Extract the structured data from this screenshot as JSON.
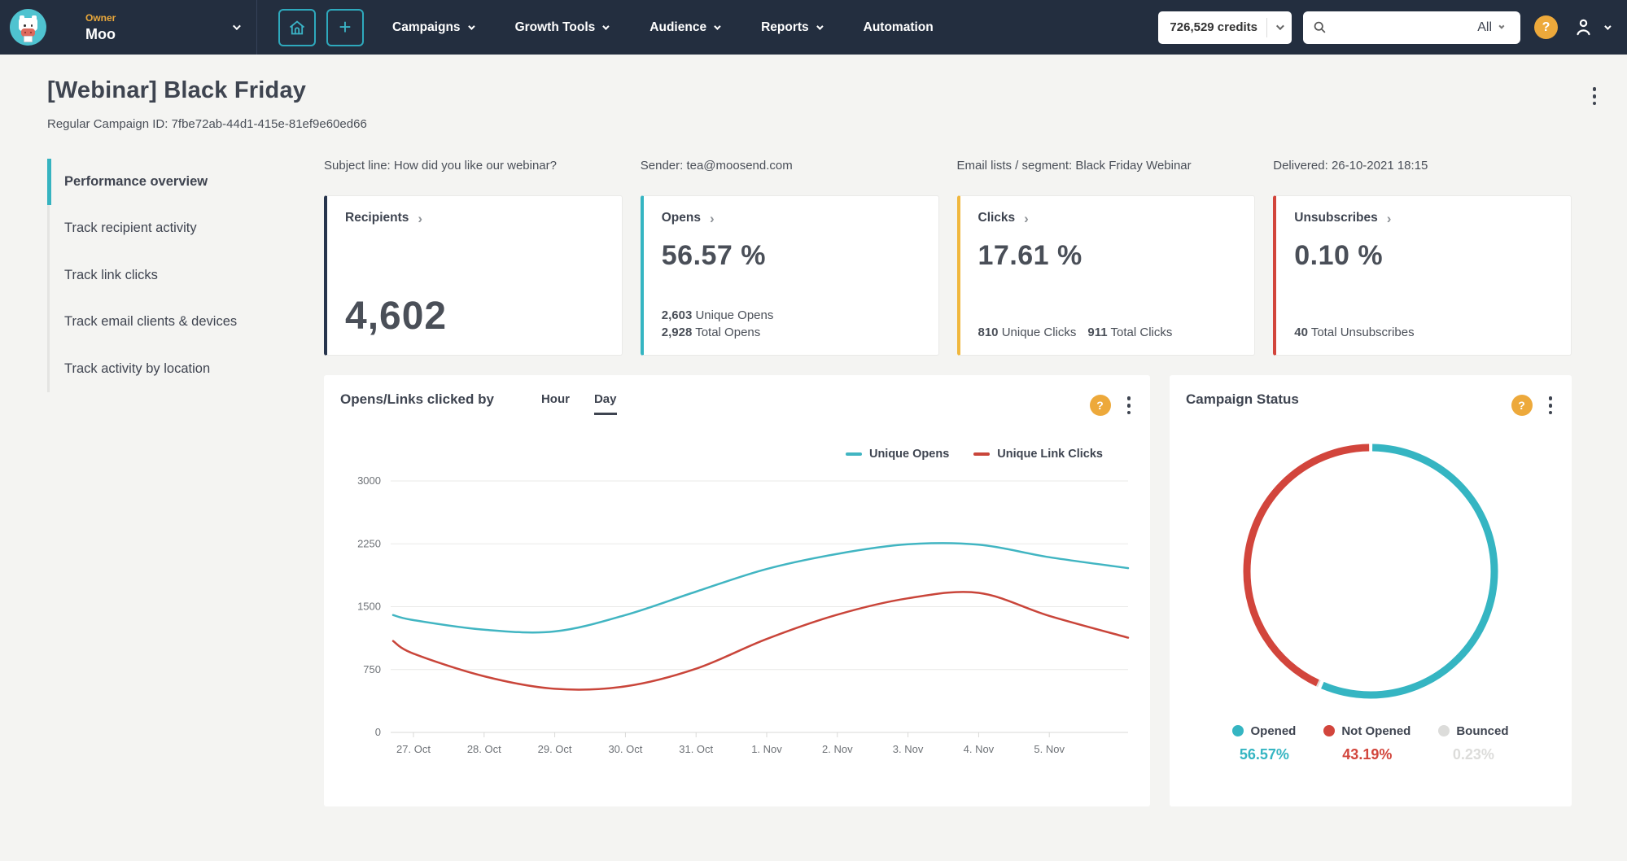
{
  "navbar": {
    "owner_label": "Owner",
    "account_name": "Moo",
    "menu": [
      {
        "label": "Campaigns",
        "chevron": true
      },
      {
        "label": "Growth Tools",
        "chevron": true
      },
      {
        "label": "Audience",
        "chevron": true
      },
      {
        "label": "Reports",
        "chevron": true
      },
      {
        "label": "Automation",
        "chevron": false
      }
    ],
    "credits": "726,529 credits",
    "search_filter": "All",
    "help_glyph": "?"
  },
  "page": {
    "title": "[Webinar] Black Friday",
    "subtitle": "Regular Campaign ID: 7fbe72ab-44d1-415e-81ef9e60ed66"
  },
  "sidebar": {
    "items": [
      {
        "label": "Performance overview",
        "active": true
      },
      {
        "label": "Track recipient activity",
        "active": false
      },
      {
        "label": "Track link clicks",
        "active": false
      },
      {
        "label": "Track email clients & devices",
        "active": false
      },
      {
        "label": "Track activity by location",
        "active": false
      }
    ]
  },
  "info": {
    "subject": "Subject line: How did you like our webinar?",
    "sender": "Sender: tea@moosend.com",
    "lists": "Email lists / segment: Black Friday Webinar",
    "delivered": "Delivered: 26-10-2021 18:15"
  },
  "cards": [
    {
      "title": "Recipients",
      "accent": "#27354d",
      "value": "4,602",
      "stats": []
    },
    {
      "title": "Opens",
      "accent": "#35b5c2",
      "value": "56.57 %",
      "stats": [
        {
          "num": "2,603",
          "label": "Unique Opens"
        },
        {
          "num": "2,928",
          "label": "Total Opens"
        }
      ]
    },
    {
      "title": "Clicks",
      "accent": "#f0b73e",
      "value": "17.61 %",
      "stats": [
        {
          "num": "810",
          "label": "Unique Clicks"
        },
        {
          "num": "911",
          "label": "Total Clicks"
        }
      ]
    },
    {
      "title": "Unsubscribes",
      "accent": "#d2453c",
      "value": "0.10 %",
      "stats": [
        {
          "num": "40",
          "label": "Total Unsubscribes"
        }
      ]
    }
  ],
  "chart_panel": {
    "title": "Opens/Links clicked by",
    "tabs": [
      "Hour",
      "Day"
    ],
    "active_tab": "Day"
  },
  "status_panel": {
    "title": "Campaign Status",
    "legend": [
      {
        "label": "Opened",
        "pct": "56.57%",
        "color": "#35b5c2"
      },
      {
        "label": "Not Opened",
        "pct": "43.19%",
        "color": "#d2453c"
      },
      {
        "label": "Bounced",
        "pct": "0.23%",
        "color": "#dcdcda"
      }
    ]
  },
  "chart_data": [
    {
      "type": "line",
      "title": "Opens/Links clicked by (Day)",
      "x": [
        "27. Oct",
        "28. Oct",
        "29. Oct",
        "30. Oct",
        "31. Oct",
        "1. Nov",
        "2. Nov",
        "3. Nov",
        "4. Nov",
        "5. Nov"
      ],
      "series": [
        {
          "name": "Unique Opens",
          "color": "#41b5c2",
          "values": [
            1340,
            1225,
            1205,
            1400,
            1680,
            1950,
            2130,
            2245,
            2240,
            2090
          ],
          "edge_start": 1400,
          "edge_end": 1960
        },
        {
          "name": "Unique Link Clicks",
          "color": "#c9453a",
          "values": [
            940,
            670,
            520,
            550,
            760,
            1115,
            1405,
            1600,
            1665,
            1390
          ],
          "edge_start": 1090,
          "edge_end": 1130
        }
      ],
      "ylim": [
        0,
        3000
      ],
      "yticks": [
        0,
        750,
        1500,
        2250,
        3000
      ],
      "grid": true,
      "legend_position": "top-right"
    },
    {
      "type": "donut",
      "title": "Campaign Status",
      "slices": [
        {
          "label": "Opened",
          "value": 56.57,
          "color": "#35b5c2"
        },
        {
          "label": "Bounced",
          "value": 0.23,
          "color": "#dcdcda"
        },
        {
          "label": "Not Opened",
          "value": 43.19,
          "color": "#d2453c"
        }
      ]
    }
  ]
}
